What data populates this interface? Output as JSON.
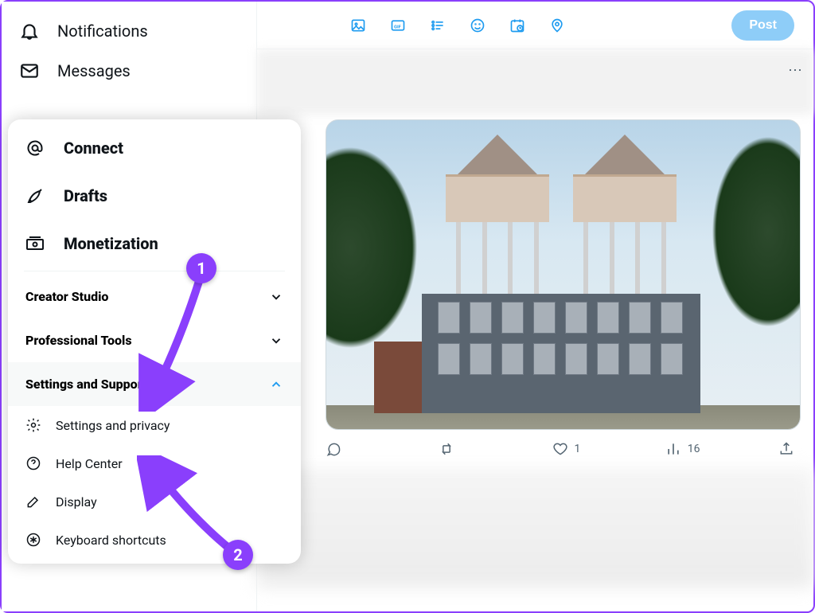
{
  "sidebar": {
    "notifications_label": "Notifications",
    "messages_label": "Messages"
  },
  "more_menu": {
    "connect_label": "Connect",
    "drafts_label": "Drafts",
    "monetization_label": "Monetization",
    "creator_studio_label": "Creator Studio",
    "professional_tools_label": "Professional Tools",
    "settings_support_label": "Settings and Support",
    "settings_privacy_label": "Settings and privacy",
    "help_center_label": "Help Center",
    "display_label": "Display",
    "keyboard_shortcuts_label": "Keyboard shortcuts"
  },
  "composer": {
    "post_button_label": "Post"
  },
  "tweet_actions": {
    "reply_count": "",
    "retweet_count": "",
    "like_count": "1",
    "views_count": "16"
  },
  "annotations": {
    "step1": "1",
    "step2": "2"
  },
  "colors": {
    "accent_purple": "#8a3ffc",
    "brand_blue": "#1d9bf0"
  }
}
